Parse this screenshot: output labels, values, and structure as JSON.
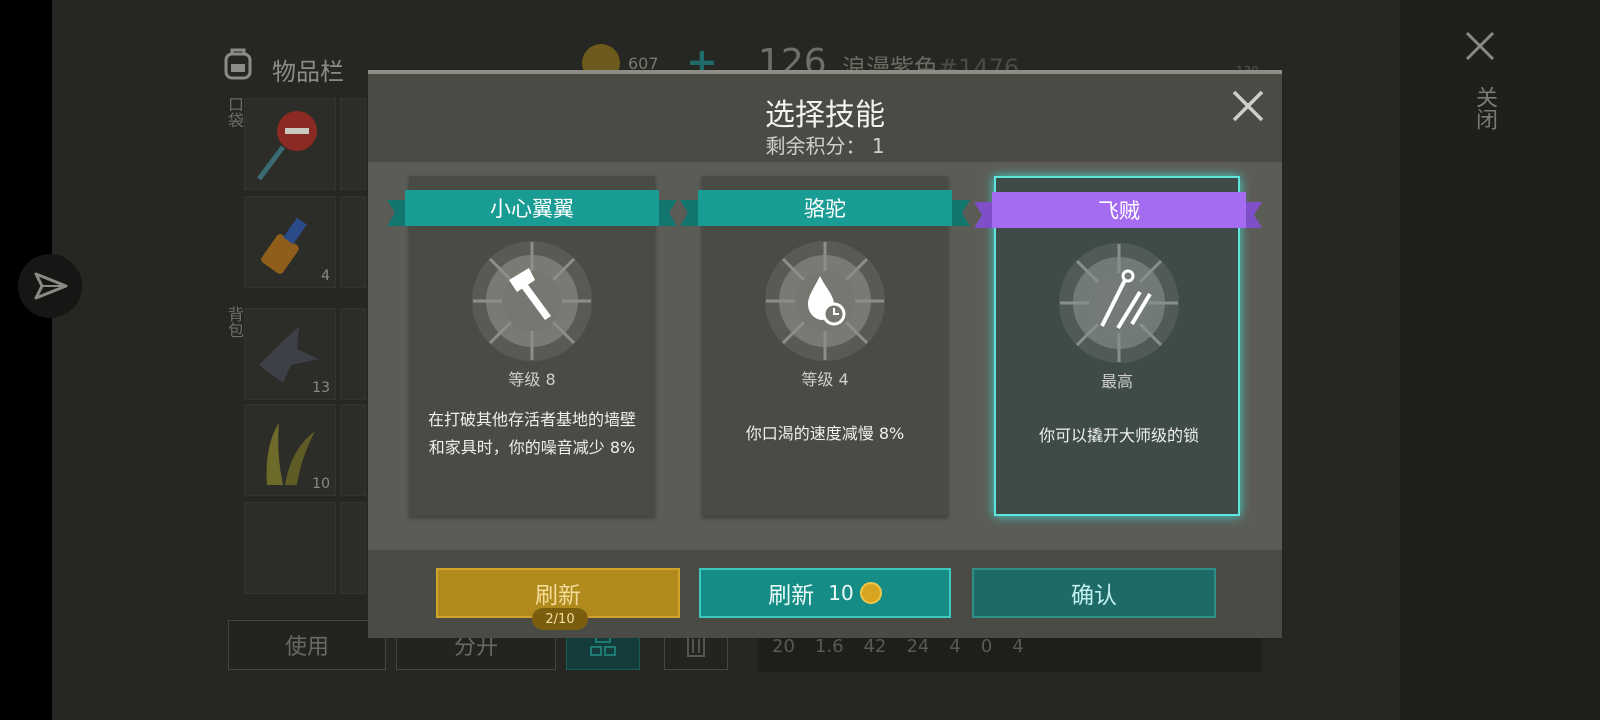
{
  "background": {
    "inventory_title": "物品栏",
    "coins": "607",
    "plus": "+",
    "player_level": "126",
    "player_name": "浪漫紫色",
    "player_id": "#1476",
    "right_number": "130",
    "pocket_label": "口袋",
    "backpack_label": "背包",
    "slot_counts": [
      "4",
      "13",
      "10"
    ],
    "buttons": [
      "使用",
      "分开"
    ],
    "stats": [
      "20",
      "1.6",
      "42",
      "24",
      "4",
      "0",
      "4"
    ],
    "close_label": "关闭"
  },
  "dialog": {
    "title": "选择技能",
    "points_label": "剩余积分：",
    "points_value": "1",
    "cards": [
      {
        "name": "小心翼翼",
        "level": "等级 8",
        "description": "在打破其他存活者基地的墙壁和家具时，你的噪音减少 8%",
        "ribbon_color": "#189c94",
        "icon": "axe-icon",
        "selected": false
      },
      {
        "name": "骆驼",
        "level": "等级 4",
        "description": "你口渴的速度减慢 8%",
        "ribbon_color": "#189c94",
        "icon": "water-drop-clock-icon",
        "selected": false
      },
      {
        "name": "飞贼",
        "level": "最高",
        "description": "你可以撬开大师级的锁",
        "ribbon_color": "#a56cf2",
        "icon": "lockpick-icon",
        "selected": true
      }
    ],
    "refresh_free_label": "刷新",
    "refresh_free_count": "2/10",
    "refresh_paid_label": "刷新",
    "refresh_paid_cost": "10",
    "confirm_label": "确认"
  }
}
